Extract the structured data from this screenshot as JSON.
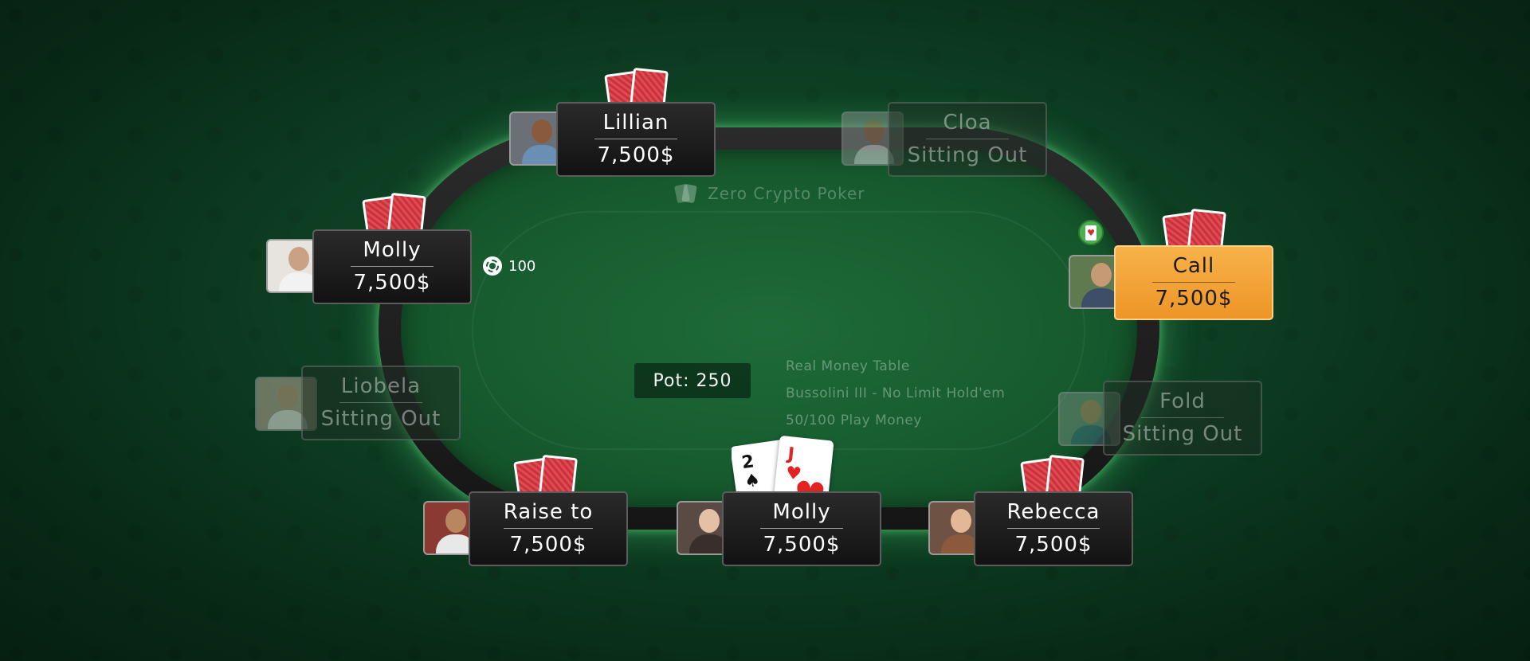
{
  "table": {
    "brand": "Zero Crypto Poker",
    "pot": "Pot: 250",
    "info": [
      "Real Money Table",
      "Bussolini III - No Limit Hold'em",
      "50/100 Play Money"
    ],
    "bet_amount": "100"
  },
  "hero_cards": [
    {
      "rank": "2",
      "suit": "♠",
      "color": "black"
    },
    {
      "rank": "J",
      "suit": "♥",
      "color": "red"
    }
  ],
  "seats": [
    {
      "id": "lillian",
      "name": "Lillian",
      "stack": "7,500$",
      "status": "playing"
    },
    {
      "id": "cloa",
      "name": "Cloa",
      "stack": "Sitting Out",
      "status": "sitting-out"
    },
    {
      "id": "molly-left",
      "name": "Molly",
      "stack": "7,500$",
      "status": "playing"
    },
    {
      "id": "call",
      "name": "Call",
      "stack": "7,500$",
      "status": "active"
    },
    {
      "id": "liobela",
      "name": "Liobela",
      "stack": "Sitting Out",
      "status": "sitting-out"
    },
    {
      "id": "fold",
      "name": "Fold",
      "stack": "Sitting Out",
      "status": "sitting-out"
    },
    {
      "id": "raise",
      "name": "Raise to",
      "stack": "7,500$",
      "status": "playing"
    },
    {
      "id": "molly-hero",
      "name": "Molly",
      "stack": "7,500$",
      "status": "hero"
    },
    {
      "id": "rebecca",
      "name": "Rebecca",
      "stack": "7,500$",
      "status": "playing"
    }
  ],
  "colors": {
    "active_plate": "#ee9527",
    "felt": "#175c2f",
    "card_back": "#c9323a"
  }
}
